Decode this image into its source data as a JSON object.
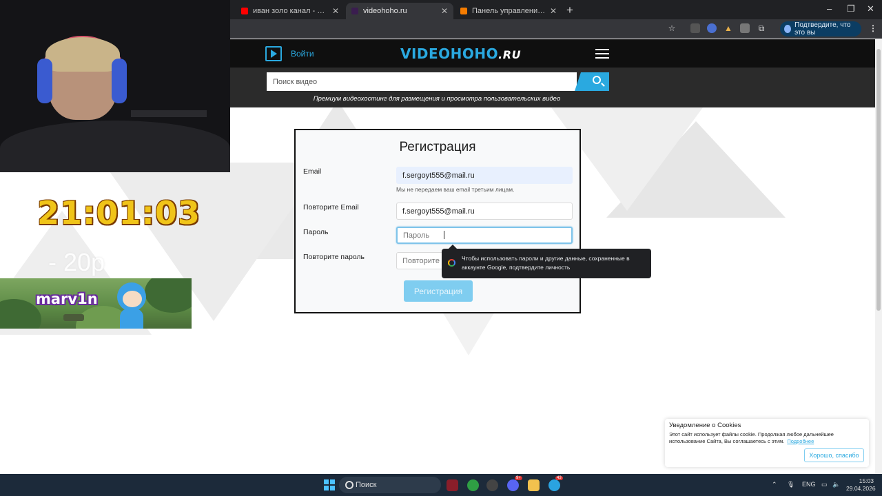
{
  "browser": {
    "tabs": [
      {
        "label": "иван золо канал - YouTube",
        "favicon_color": "#ff0000",
        "active": false
      },
      {
        "label": "videohoho.ru",
        "favicon_color": "#3a1d4f",
        "active": true
      },
      {
        "label": "Панель управления - Donation",
        "favicon_color": "#f57c00",
        "active": false
      }
    ],
    "tab_close_glyph": "✕",
    "new_tab_glyph": "+",
    "window_controls": [
      "–",
      "❐",
      "✕"
    ],
    "profile_pill": "Подтвердите, что это вы",
    "menu_glyph": "⋮"
  },
  "site": {
    "login_label": "Войти",
    "logo_main": "VIDEOHOHO",
    "logo_suffix": ".RU",
    "search_placeholder": "Поиск видео",
    "tagline": "Премиум видеохостинг для размещения и просмотра пользовательских видео",
    "accent_color": "#2aa9e0"
  },
  "form": {
    "title": "Регистрация",
    "email_label": "Email",
    "email_value": "f.sergoyt555@mail.ru",
    "email_hint": "Мы не передаем ваш email третьим лицам.",
    "repeat_email_label": "Повторите Email",
    "repeat_email_value": "f.sergoyt555@mail.ru",
    "password_label": "Пароль",
    "password_placeholder": "Пароль",
    "repeat_password_label": "Повторите пароль",
    "repeat_password_placeholder": "Повторите пароль",
    "submit_label": "Регистрация"
  },
  "password_tooltip": "Чтобы использовать пароли и другие данные, сохраненные в аккаунте Google, подтвердите личность",
  "cookie": {
    "title": "Уведомление о Cookies",
    "text": "Этот сайт использует файлы cookie. Продолжая любое дальнейшее использование Сайта, Вы соглашаетесь с этим.",
    "link": "Подробнее",
    "button": "Хорошо, спасибо"
  },
  "overlay": {
    "clock": "21:01:03",
    "donate_text": "- 20р",
    "banner_name": "marv1n"
  },
  "taskbar": {
    "search_label": "Поиск",
    "lang": "ENG",
    "time": "15:03",
    "date": "29.04.2026",
    "badge_discord": "9+",
    "badge_telegram": "43"
  }
}
